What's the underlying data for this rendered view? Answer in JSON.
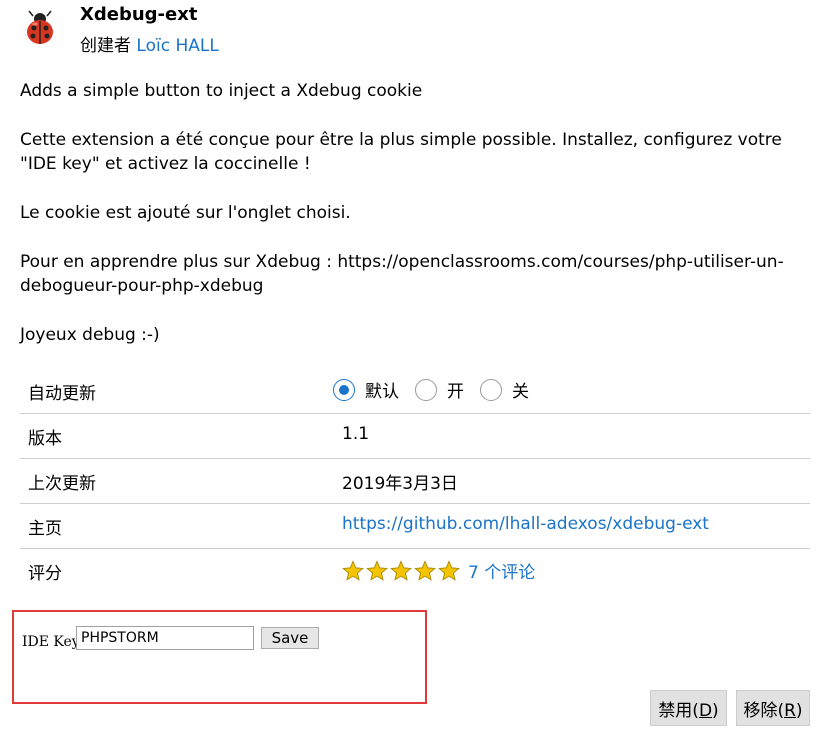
{
  "extension": {
    "name": "Xdebug-ext",
    "author_label": "创建者",
    "author_name": "Loïc HALL",
    "icon": "ladybug-icon"
  },
  "description": [
    "Adds a simple button to inject a Xdebug cookie",
    "Cette extension a été conçue pour être la plus simple possible. Installez, configurez votre \"IDE key\" et activez la coccinelle !",
    "Le cookie est ajouté sur l'onglet choisi.",
    "Pour en apprendre plus sur Xdebug : https://openclassrooms.com/courses/php-utiliser-un-debogueur-pour-php-xdebug",
    "Joyeux debug :-)"
  ],
  "details": {
    "auto_update": {
      "label": "自动更新",
      "options": [
        "默认",
        "开",
        "关"
      ],
      "selected": "默认"
    },
    "version": {
      "label": "版本",
      "value": "1.1"
    },
    "last_updated": {
      "label": "上次更新",
      "value": "2019年3月3日"
    },
    "homepage": {
      "label": "主页",
      "value": "https://github.com/lhall-adexos/xdebug-ext"
    },
    "rating": {
      "label": "评分",
      "stars": 5,
      "reviews": "7 个评论"
    }
  },
  "options": {
    "ide_key_label": "IDE Key",
    "ide_key_value": "PHPSTORM",
    "save_label": "Save"
  },
  "buttons": {
    "disable": {
      "label": "禁用(",
      "accel": "D",
      "close": ")"
    },
    "remove": {
      "label": "移除(",
      "accel": "R",
      "close": ")"
    }
  },
  "colors": {
    "link": "#1a73c8",
    "highlight_border": "#e03a3a",
    "star": "#f5c400"
  }
}
